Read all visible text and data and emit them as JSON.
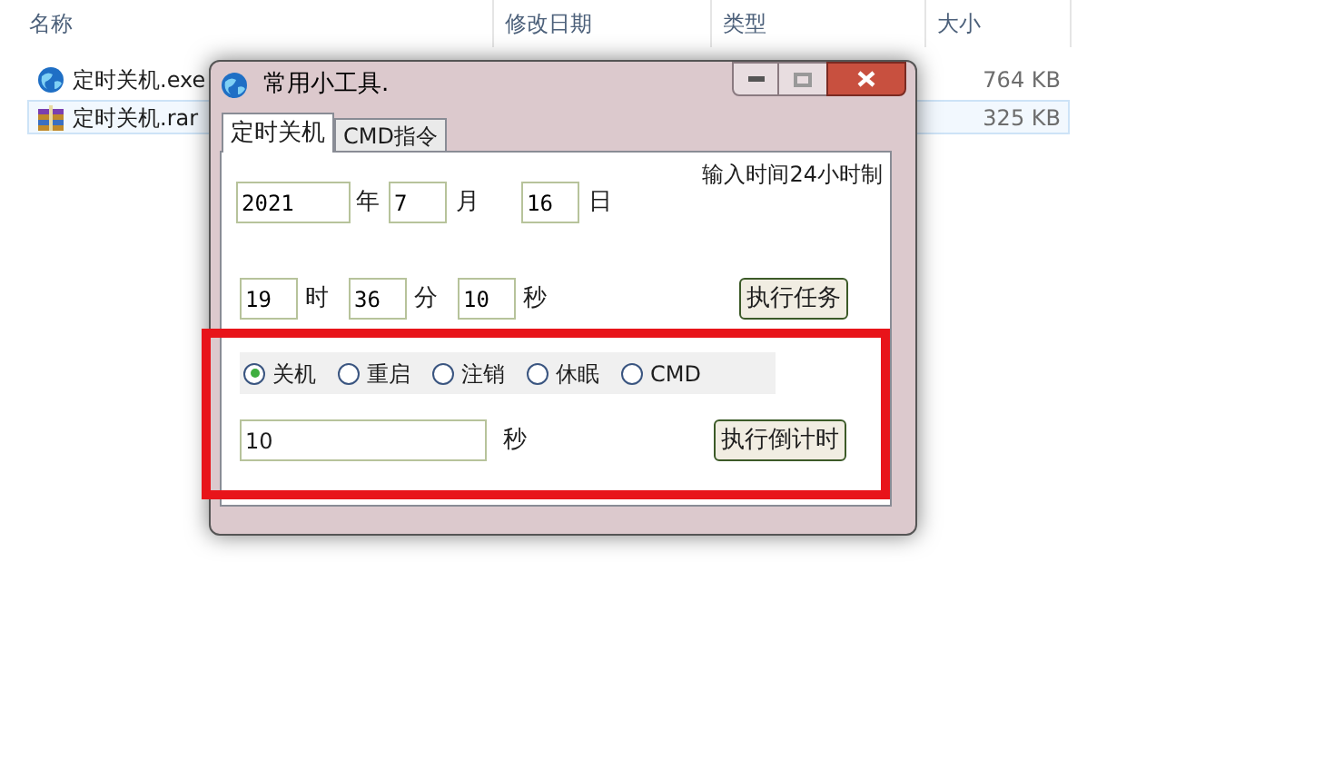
{
  "explorer": {
    "columns": [
      "名称",
      "修改日期",
      "类型",
      "大小"
    ],
    "files": [
      {
        "name": "定时关机.exe",
        "size": "764 KB",
        "selected": false,
        "kind": "exe"
      },
      {
        "name": "定时关机.rar",
        "size": "325 KB",
        "selected": true,
        "kind": "archive"
      }
    ]
  },
  "dialog": {
    "title": "常用小工具.",
    "tabs": [
      {
        "label": "定时关机",
        "selected": true
      },
      {
        "label": "CMD指令",
        "selected": false
      }
    ],
    "hint": "输入时间24小时制",
    "date_fields": [
      {
        "value": "2021",
        "unit": "年"
      },
      {
        "value": "7",
        "unit": "月"
      },
      {
        "value": "16",
        "unit": "日"
      }
    ],
    "time_fields": [
      {
        "value": "19",
        "unit": "时"
      },
      {
        "value": "36",
        "unit": "分"
      },
      {
        "value": "10",
        "unit": "秒"
      }
    ],
    "run_task_button": "执行任务",
    "actions": [
      {
        "label": "关机",
        "selected": true
      },
      {
        "label": "重启",
        "selected": false
      },
      {
        "label": "注销",
        "selected": false
      },
      {
        "label": "休眠",
        "selected": false
      },
      {
        "label": "CMD",
        "selected": false
      }
    ],
    "countdown": {
      "value": "10",
      "unit": "秒"
    },
    "countdown_button": "执行倒计时"
  }
}
